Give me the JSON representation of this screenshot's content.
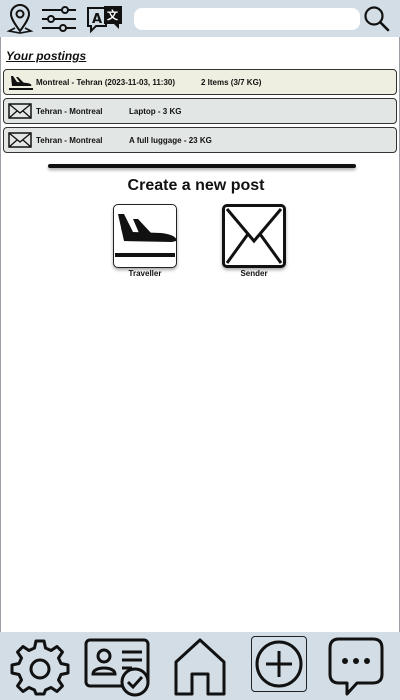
{
  "header": {
    "location_icon": "location-pin-icon",
    "filter_icon": "sliders-icon",
    "translate_icon": "translate-icon",
    "search_placeholder": "",
    "search_icon": "search-icon"
  },
  "postings": {
    "title": "Your postings",
    "items": [
      {
        "icon": "airplane-landing-icon",
        "route": "Montreal - Tehran (2023-11-03, 11:30)",
        "details": "2 Items  (3/7 KG)"
      },
      {
        "icon": "envelope-icon",
        "route": "Tehran - Montreal",
        "details": "Laptop - 3 KG"
      },
      {
        "icon": "envelope-icon",
        "route": "Tehran - Montreal",
        "details": "A full luggage - 23 KG"
      }
    ]
  },
  "create": {
    "title": "Create a new post",
    "options": [
      {
        "label": "Traveller",
        "icon": "airplane-landing-icon"
      },
      {
        "label": "Sender",
        "icon": "envelope-icon"
      }
    ]
  },
  "bottom_nav": [
    {
      "name": "settings",
      "icon": "gear-icon"
    },
    {
      "name": "profile",
      "icon": "id-card-check-icon"
    },
    {
      "name": "home",
      "icon": "home-icon"
    },
    {
      "name": "new-post",
      "icon": "plus-circle-icon"
    },
    {
      "name": "messages",
      "icon": "chat-bubble-icon"
    }
  ],
  "colors": {
    "bar_background": "#d2dde5",
    "highlight_row": "#eeeee1",
    "row": "#e2e6e4"
  }
}
